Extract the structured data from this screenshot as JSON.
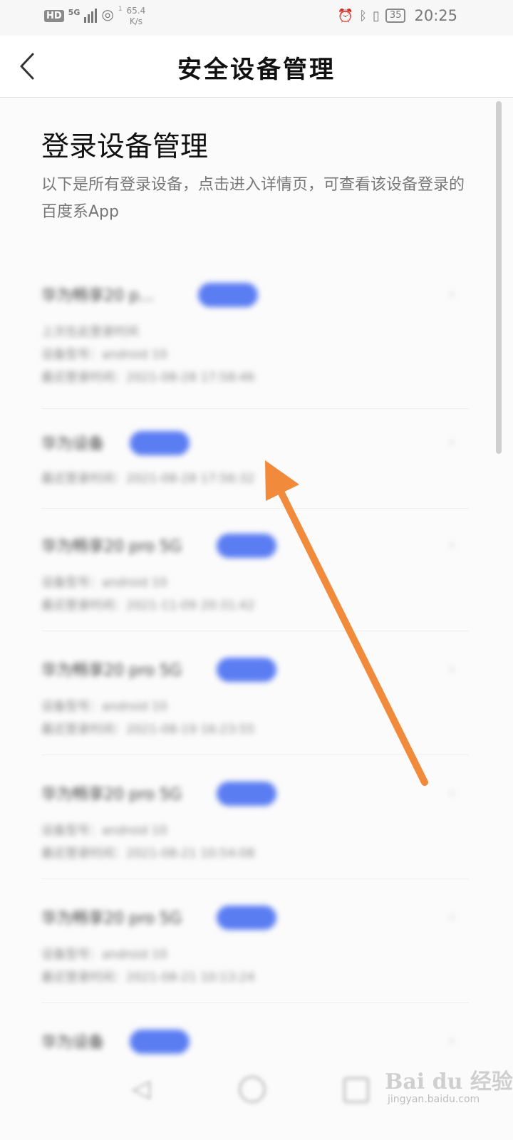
{
  "status_bar": {
    "network_badge": "HD",
    "signal_label": "5G",
    "speed_value": "65.4",
    "speed_unit": "K/s",
    "speed_prefix": "1",
    "battery": "35",
    "time": "20:25"
  },
  "header": {
    "title": "安全设备管理"
  },
  "main": {
    "section_title": "登录设备管理",
    "section_desc": "以下是所有登录设备，点击进入详情页，可查看该设备登录的百度系App"
  },
  "device_list": {
    "items": [
      {
        "name": "华为畅享20 p...",
        "line1": "上次在此登录时间",
        "line2": "设备型号：android 10",
        "line3": "最近登录时间：2021-08-28 17:58:46",
        "chevron": "›"
      },
      {
        "name": "华为设备",
        "line1": "最近登录时间：2021-08-28 17:56:32",
        "chevron": "›"
      },
      {
        "name": "华为畅享20 pro 5G",
        "line1": "设备型号：android 10",
        "line2": "最近登录时间：2021-11-09 20:31:42",
        "chevron": "›"
      },
      {
        "name": "华为畅享20 pro 5G",
        "line1": "设备型号：android 10",
        "line2": "最近登录时间：2021-08-19 16:23:55",
        "chevron": "›"
      },
      {
        "name": "华为畅享20 pro 5G",
        "line1": "设备型号：android 10",
        "line2": "最近登录时间：2021-08-21 10:54:08",
        "chevron": "›"
      },
      {
        "name": "华为畅享20 pro 5G",
        "line1": "设备型号：android 10",
        "line2": "最近登录时间：2021-08-21 10:13:24",
        "chevron": "›"
      },
      {
        "name": "华为设备",
        "chevron": "›"
      }
    ]
  },
  "watermark": {
    "logo": "Bai du 经验",
    "url": "jingyan.baidu.com"
  },
  "colors": {
    "tag_blue": "#5b7df2",
    "arrow_orange": "#f28a3c",
    "title_text": "#111111",
    "desc_text": "#777777"
  },
  "icons": {
    "back": "chevron-left-icon",
    "row_chevron": "chevron-right-icon",
    "arrow": "annotation-arrow-icon"
  }
}
